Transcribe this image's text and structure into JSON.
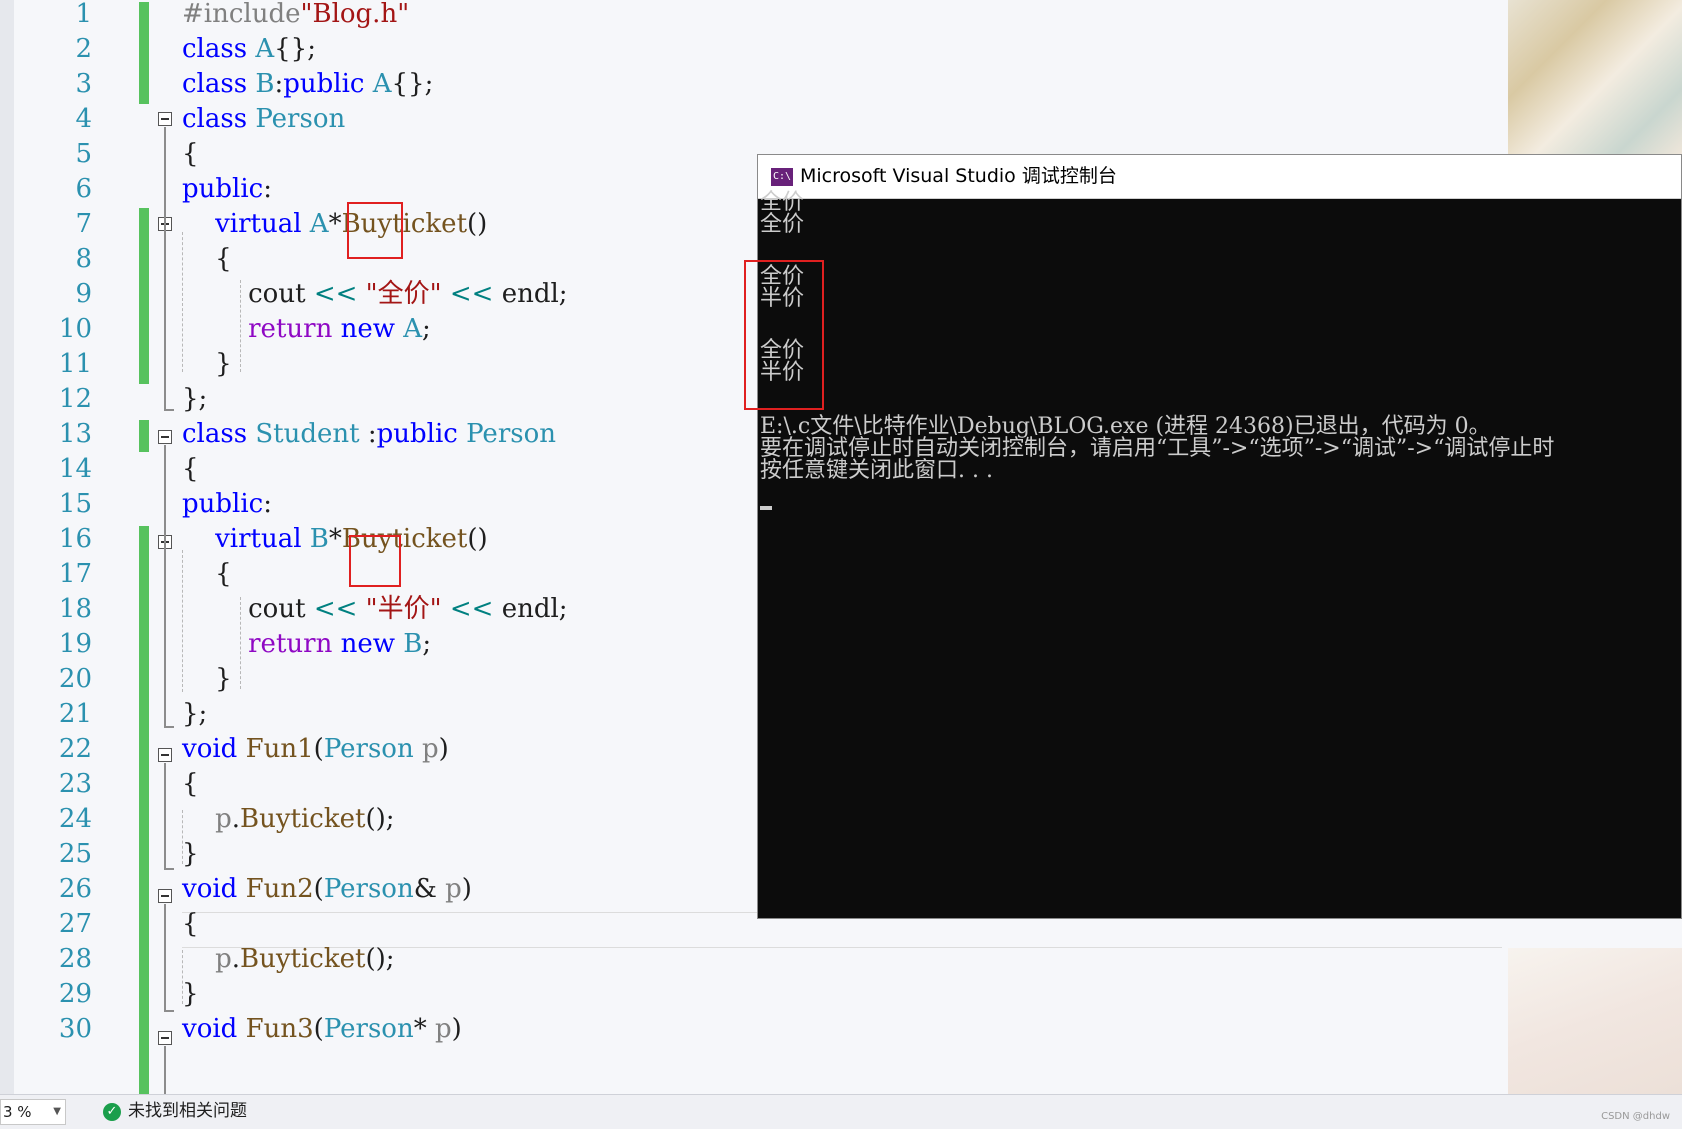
{
  "editor": {
    "line_numbers": [
      "1",
      "2",
      "3",
      "4",
      "5",
      "6",
      "7",
      "8",
      "9",
      "10",
      "11",
      "12",
      "13",
      "14",
      "15",
      "16",
      "17",
      "18",
      "19",
      "20",
      "21",
      "22",
      "23",
      "24",
      "25",
      "26",
      "27",
      "28",
      "29",
      "30"
    ],
    "code": {
      "l1_pp": "#include",
      "l1_str": "\"Blog.h\"",
      "l2_kw": "class",
      "l2_ty": "A",
      "l2_rest": "{};",
      "l3_kw": "class",
      "l3_ty": "B",
      "l3_colon": ":",
      "l3_kw2": "public",
      "l3_ty2": "A",
      "l3_rest": "{};",
      "l4_kw": "class",
      "l4_ty": "Person",
      "l5": "{",
      "l6_kw": "public",
      "l6_colon": ":",
      "l7_kw": "virtual",
      "l7_ty": "A",
      "l7_star": "*",
      "l7_fn": "Buyticket",
      "l7_paren": "()",
      "l8": "{",
      "l9_a": "cout",
      "l9_op": "<<",
      "l9_str": "\"全价\"",
      "l9_op2": "<<",
      "l9_b": "endl;",
      "l10_ret": "return",
      "l10_kw": "new",
      "l10_ty": "A",
      "l10_semi": ";",
      "l11": "}",
      "l12": "};",
      "l13_kw": "class",
      "l13_ty": "Student",
      "l13_colon": ":",
      "l13_kw2": "public",
      "l13_ty2": "Person",
      "l14": "{",
      "l15_kw": "public",
      "l15_colon": ":",
      "l16_kw": "virtual",
      "l16_ty": "B",
      "l16_star": "*",
      "l16_fn": "Buyticket",
      "l16_paren": "()",
      "l17": "{",
      "l18_a": "cout",
      "l18_op": "<<",
      "l18_str": "\"半价\"",
      "l18_op2": "<<",
      "l18_b": "endl;",
      "l19_ret": "return",
      "l19_kw": "new",
      "l19_ty": "B",
      "l19_semi": ";",
      "l20": "}",
      "l21": "};",
      "l22_kw": "void",
      "l22_fn": "Fun1",
      "l22_open": "(",
      "l22_ty": "Person",
      "l22_p": "p",
      "l22_close": ")",
      "l23": "{",
      "l24_p": "p",
      "l24_dot": ".",
      "l24_fn": "Buyticket",
      "l24_rest": "();",
      "l25": "}",
      "l26_kw": "void",
      "l26_fn": "Fun2",
      "l26_open": "(",
      "l26_ty": "Person",
      "l26_amp": "&",
      "l26_p": "p",
      "l26_close": ")",
      "l27": "{",
      "l28_p": "p",
      "l28_dot": ".",
      "l28_fn": "Buyticket",
      "l28_rest": "();",
      "l29": "}",
      "l30_kw": "void",
      "l30_fn": "Fun3",
      "l30_open": "(",
      "l30_ty": "Person",
      "l30_star": "*",
      "l30_p": "p",
      "l30_close": ")"
    }
  },
  "console": {
    "title": "Microsoft Visual Studio 调试控制台",
    "icon_text": "C:\\",
    "output": [
      "全价",
      "全价",
      "",
      "全价",
      "半价",
      "",
      "全价",
      "半价",
      "",
      "",
      "E:\\.c文件\\比特作业\\Debug\\BLOG.exe (进程 24368)已退出，代码为 0。",
      "要在调试停止时自动关闭控制台，请启用“工具”->“选项”->“调试”->“调试停止时",
      "按任意键关闭此窗口. . ."
    ]
  },
  "status_bar": {
    "zoom": "3 %",
    "issues_text": "未找到相关问题",
    "watermark": "CSDN @dhdw"
  },
  "colors": {
    "keyword": "#0000ff",
    "type": "#2b91af",
    "function": "#74531f",
    "string": "#a31515",
    "return_keyword": "#8f08c4",
    "change_bar": "#57c25e",
    "highlight_box": "#e02020",
    "console_bg": "#0c0c0c",
    "console_text": "#cccccc"
  },
  "icons": {
    "fold": "collapse-minus-icon",
    "status": "check-circle-icon",
    "console": "console-app-icon"
  }
}
